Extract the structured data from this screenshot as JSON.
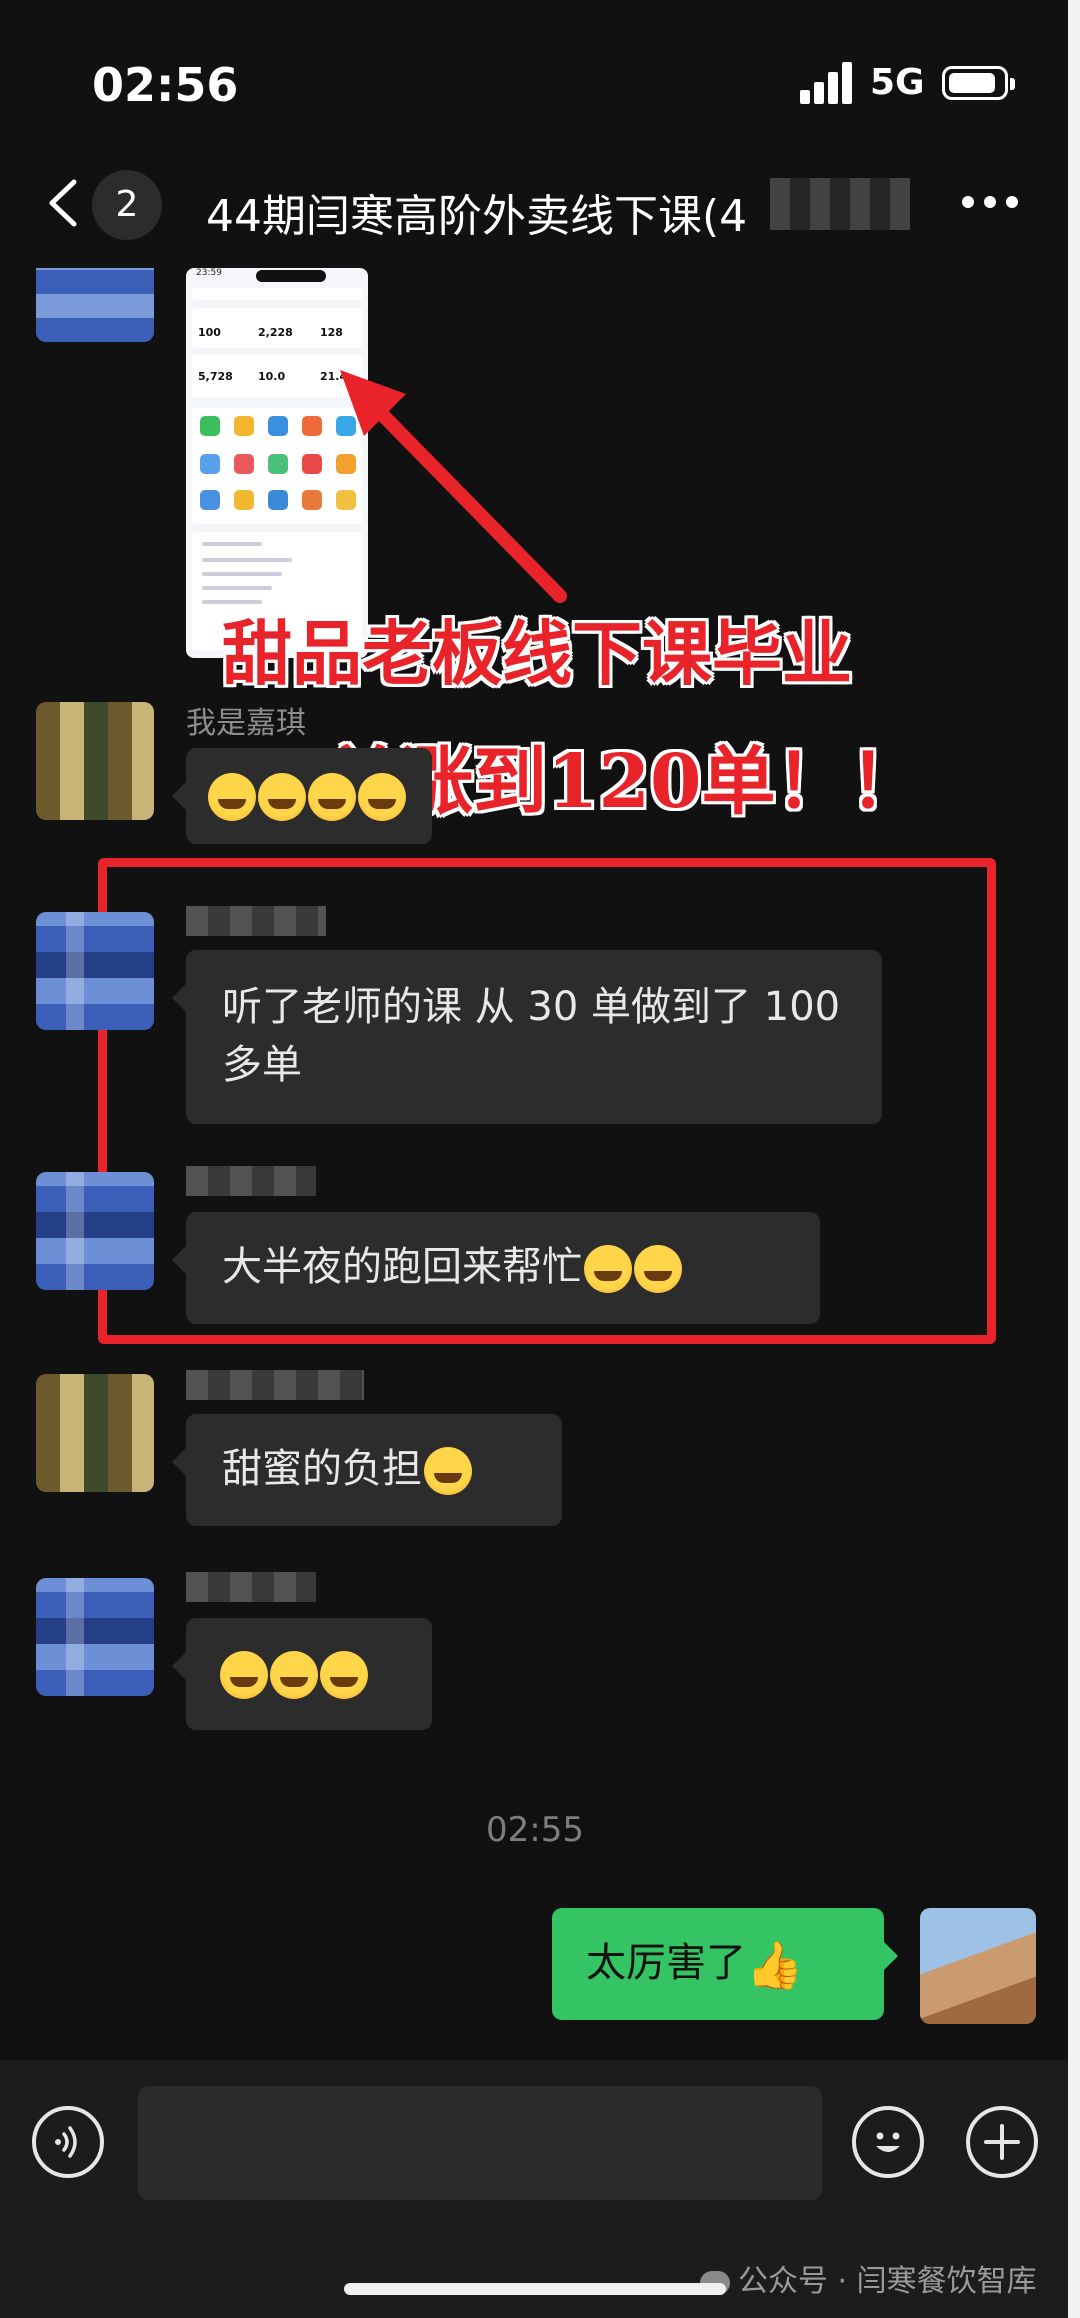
{
  "status_bar": {
    "time": "02:56",
    "network": "5G"
  },
  "nav": {
    "unread_count": "2",
    "title": "44期闫寒高阶外卖线下课(4"
  },
  "screenshot_thumb": {
    "time": "23:59",
    "values": [
      "100",
      "2,228",
      "128",
      "5,728",
      "10.0",
      "21.4"
    ]
  },
  "annotation": {
    "line1": "甜品老板线下课毕业",
    "line2": "30单涨到120单！！"
  },
  "messages": [
    {
      "sender": "我是嘉琪",
      "text": ""
    },
    {
      "sender": "",
      "text": "听了老师的课 从 30 单做到了 100 多单"
    },
    {
      "sender": "",
      "text": "大半夜的跑回来帮忙"
    },
    {
      "sender": "",
      "text": "甜蜜的负担"
    },
    {
      "sender": "",
      "text": ""
    }
  ],
  "timestamp": "02:55",
  "my_message": {
    "text": "太厉害了"
  },
  "watermark": "公众号 · 闫寒餐饮智库",
  "colors": {
    "accent_green": "#34c463",
    "highlight_red": "#e8232a",
    "background": "#111111"
  },
  "icons": [
    "back-icon",
    "more-icon",
    "voice-icon",
    "emoji-icon",
    "plus-icon",
    "signal-icon",
    "battery-icon"
  ]
}
